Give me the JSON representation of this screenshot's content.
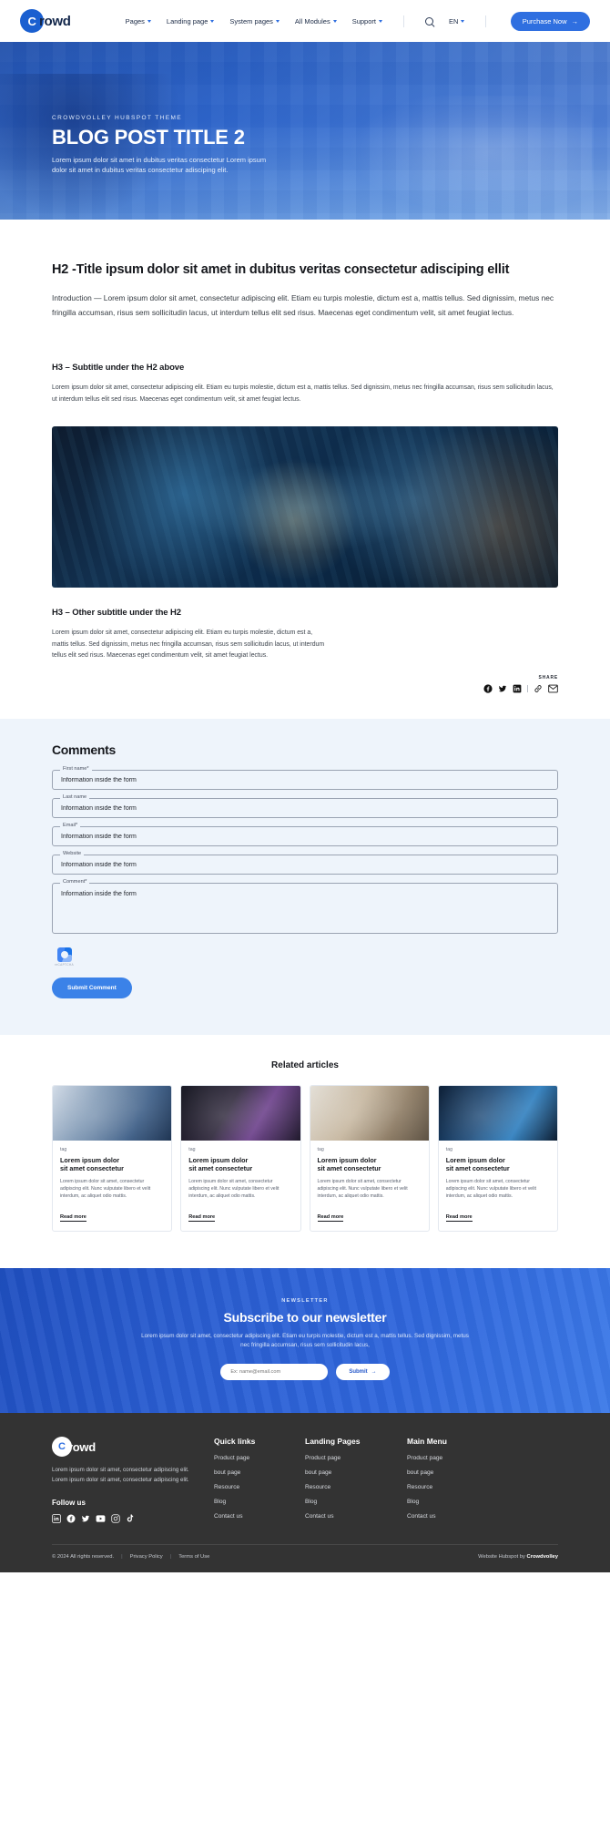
{
  "header": {
    "logo_mark": "C",
    "logo_text": "rowd",
    "nav": [
      {
        "label": "Pages",
        "has_caret": true
      },
      {
        "label": "Landing page",
        "has_caret": true
      },
      {
        "label": "System pages",
        "has_caret": true
      },
      {
        "label": "All Modules",
        "has_caret": true
      },
      {
        "label": "Support",
        "has_caret": true
      }
    ],
    "search_icon": "search-icon",
    "lang": "EN",
    "cta": "Purchase Now",
    "cta_arrow": "→"
  },
  "hero": {
    "eyebrow": "CROWDVOLLEY HUBSPOT THEME",
    "title": "BLOG POST TITLE 2",
    "subtitle": "Lorem ipsum dolor sit amet in dubitus veritas consectetur Lorem ipsum dolor sit amet in dubitus veritas consectetur adisciping elit."
  },
  "article": {
    "h2": "H2 -Title ipsum dolor sit amet in dubitus veritas consectetur adisciping ellit",
    "intro": "Introduction — Lorem ipsum dolor sit amet, consectetur adipiscing elit. Etiam eu turpis molestie, dictum est a, mattis tellus. Sed dignissim, metus nec fringilla accumsan, risus sem sollicitudin lacus, ut interdum tellus elit sed risus. Maecenas eget condimentum velit, sit amet feugiat lectus.",
    "h3_a": "H3 – Subtitle under the H2 above",
    "body_a": "Lorem ipsum dolor sit amet, consectetur adipiscing elit. Etiam eu turpis molestie, dictum est a, mattis tellus. Sed dignissim, metus nec fringilla accumsan, risus sem sollicitudin lacus, ut interdum tellus elit sed risus. Maecenas eget condimentum velit, sit amet feugiat lectus.",
    "h3_b": "H3 – Other subtitle under  the H2",
    "body_b": "Lorem ipsum dolor sit amet, consectetur adipiscing elit. Etiam eu turpis molestie, dictum est a, mattis tellus. Sed dignissim, metus nec fringilla accumsan, risus sem sollicitudin lacus, ut interdum tellus elit sed risus. Maecenas eget condimentum velit, sit amet feugiat lectus.",
    "share_label": "SHARE",
    "share_icons": [
      "facebook-icon",
      "twitter-icon",
      "linkedin-icon",
      "link-icon",
      "email-icon"
    ]
  },
  "comments": {
    "title": "Comments",
    "fields": [
      {
        "label": "First name*",
        "value": "Information inside the form",
        "name": "first-name"
      },
      {
        "label": "Last name",
        "value": "Information inside the form",
        "name": "last-name"
      },
      {
        "label": "Email*",
        "value": "Information inside the form",
        "name": "email"
      },
      {
        "label": "Website",
        "value": "Information inside the form",
        "name": "website"
      }
    ],
    "comment_field": {
      "label": "Comment*",
      "value": "Information inside the form",
      "name": "comment"
    },
    "recaptcha_label": "reCAPTCHA",
    "submit": "Submit Comment"
  },
  "related": {
    "title": "Related articles",
    "cards": [
      {
        "tag": "tag",
        "title": "Lorem ipsum dolor\nsit amet consectetur",
        "desc": "Lorem ipsum dolor sit amet, consectetur adipiscing elit. Nunc vulputate libero et velit interdum, ac aliquet odio mattis.",
        "link": "Read more"
      },
      {
        "tag": "tag",
        "title": "Lorem ipsum dolor\nsit amet consectetur",
        "desc": "Lorem ipsum dolor sit amet, consectetur adipiscing elit. Nunc vulputate libero et velit interdum, ac aliquet odio mattis.",
        "link": "Read more"
      },
      {
        "tag": "tag",
        "title": "Lorem ipsum dolor\nsit amet consectetur",
        "desc": "Lorem ipsum dolor sit amet, consectetur adipiscing elit. Nunc vulputate libero et velit interdum, ac aliquet odio mattis.",
        "link": "Read more"
      },
      {
        "tag": "tag",
        "title": "Lorem ipsum dolor\nsit amet consectetur",
        "desc": "Lorem ipsum dolor sit amet, consectetur adipiscing elit. Nunc vulputate libero et velit interdum, ac aliquet odio mattis.",
        "link": "Read more"
      }
    ]
  },
  "newsletter": {
    "eyebrow": "NEWSLETTER",
    "title": "Subscribe to our newsletter",
    "subtitle": "Lorem ipsum dolor sit amet, consectetur adipiscing elit. Etiam eu turpis molestie, dictum est a, mattis tellus. Sed dignissim, metus nec fringilla accumsan, risus sem sollicitudin lacus,",
    "input_placeholder": "Ex: name@email.com",
    "submit": "Submit",
    "submit_arrow": "→"
  },
  "footer": {
    "logo_mark": "C",
    "logo_text": "rowd",
    "description": "Lorem ipsum dolor sit amet, consectetur adipiscing elit. Lorem ipsum dolor sit amet, consectetur adipiscing elit.",
    "follow_title": "Follow us",
    "social": [
      "linkedin-icon",
      "facebook-icon",
      "twitter-icon",
      "youtube-icon",
      "instagram-icon",
      "tiktok-icon"
    ],
    "columns": [
      {
        "title": "Quick links",
        "links": [
          "Product page",
          "bout page",
          "Resource",
          "Blog",
          "Contact us"
        ]
      },
      {
        "title": "Landing Pages",
        "links": [
          "Product page",
          "bout page",
          "Resource",
          "Blog",
          "Contact us"
        ]
      },
      {
        "title": "Main Menu",
        "links": [
          "Product page",
          "bout page",
          "Resource",
          "Blog",
          "Contact us"
        ]
      }
    ],
    "copyright": "© 2024 All rights reserved.",
    "privacy": "Privacy Policy",
    "terms": "Terms of Use",
    "credit_prefix": "Website Hubspot by ",
    "credit_brand": "Crowdvolley"
  },
  "colors": {
    "brand_blue": "#2f6fe0",
    "hero_blue": "#3b72cf",
    "footer_bg": "#333333",
    "comments_bg": "#eef4fb"
  }
}
